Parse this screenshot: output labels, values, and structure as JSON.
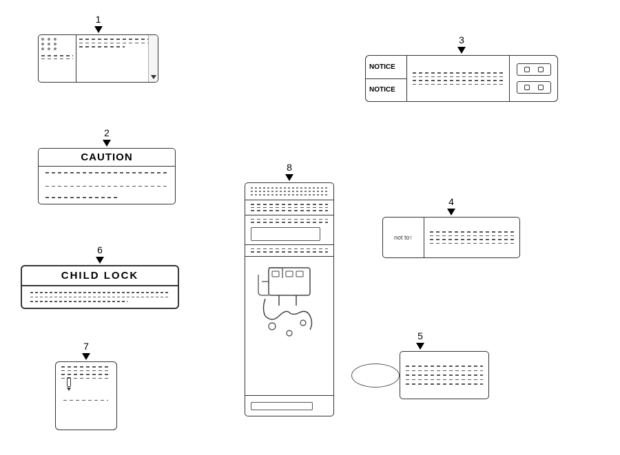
{
  "items": {
    "item1": {
      "number": "1",
      "description": "Horizontal label with scroll indicator"
    },
    "item2": {
      "number": "2",
      "header": "CAUTION",
      "lines": [
        "dashed line 1",
        "dashed line 2",
        "dashed line short"
      ]
    },
    "item3": {
      "number": "3",
      "notice1": "NOTICE",
      "notice2": "NOTICE",
      "description": "Notice label with connector"
    },
    "item4": {
      "number": "4",
      "icon_text": "not to↑",
      "description": "Label with icon and lines"
    },
    "item5": {
      "number": "5",
      "description": "Oval with box label"
    },
    "item6": {
      "number": "6",
      "header": "CHILD  LOCK",
      "description": "Child lock label"
    },
    "item7": {
      "number": "7",
      "description": "Small card label"
    },
    "item8": {
      "number": "8",
      "description": "Tall vertical label with engine diagram"
    }
  }
}
